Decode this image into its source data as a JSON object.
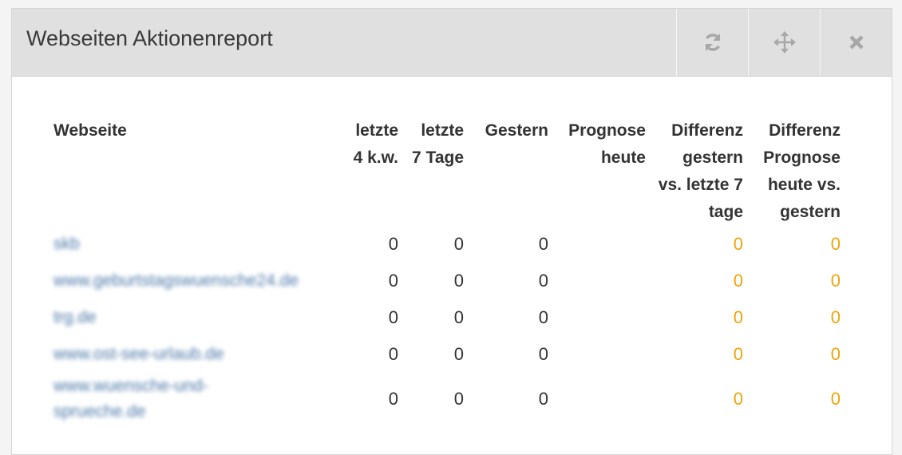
{
  "widget": {
    "title": "Webseiten Aktionenreport",
    "icons": [
      "refresh-icon",
      "move-icon",
      "close-icon"
    ]
  },
  "colors": {
    "accent_orange": "#f0a30a",
    "link_blue": "#4c78a8"
  },
  "table": {
    "headers": {
      "site": "Webseite",
      "last4kw": "letzte 4 k.w.",
      "last7": "letzte 7 Tage",
      "yesterday": "Gestern",
      "forecast": "Prognose heute",
      "diff1": "Differenz gestern vs. letzte 7 tage",
      "diff2": "Differenz Prognose heute vs. gestern"
    },
    "rows": [
      {
        "site": "skb",
        "last4kw": "0",
        "last7": "0",
        "yesterday": "0",
        "forecast": "",
        "diff1": "0",
        "diff2": "0"
      },
      {
        "site": "www.geburtstagswuensche24.de",
        "last4kw": "0",
        "last7": "0",
        "yesterday": "0",
        "forecast": "",
        "diff1": "0",
        "diff2": "0"
      },
      {
        "site": "trg.de",
        "last4kw": "0",
        "last7": "0",
        "yesterday": "0",
        "forecast": "",
        "diff1": "0",
        "diff2": "0"
      },
      {
        "site": "www.ost-see-urlaub.de",
        "last4kw": "0",
        "last7": "0",
        "yesterday": "0",
        "forecast": "",
        "diff1": "0",
        "diff2": "0"
      },
      {
        "site": "www.wuensche-und-sprueche.de",
        "last4kw": "0",
        "last7": "0",
        "yesterday": "0",
        "forecast": "",
        "diff1": "0",
        "diff2": "0"
      }
    ]
  }
}
